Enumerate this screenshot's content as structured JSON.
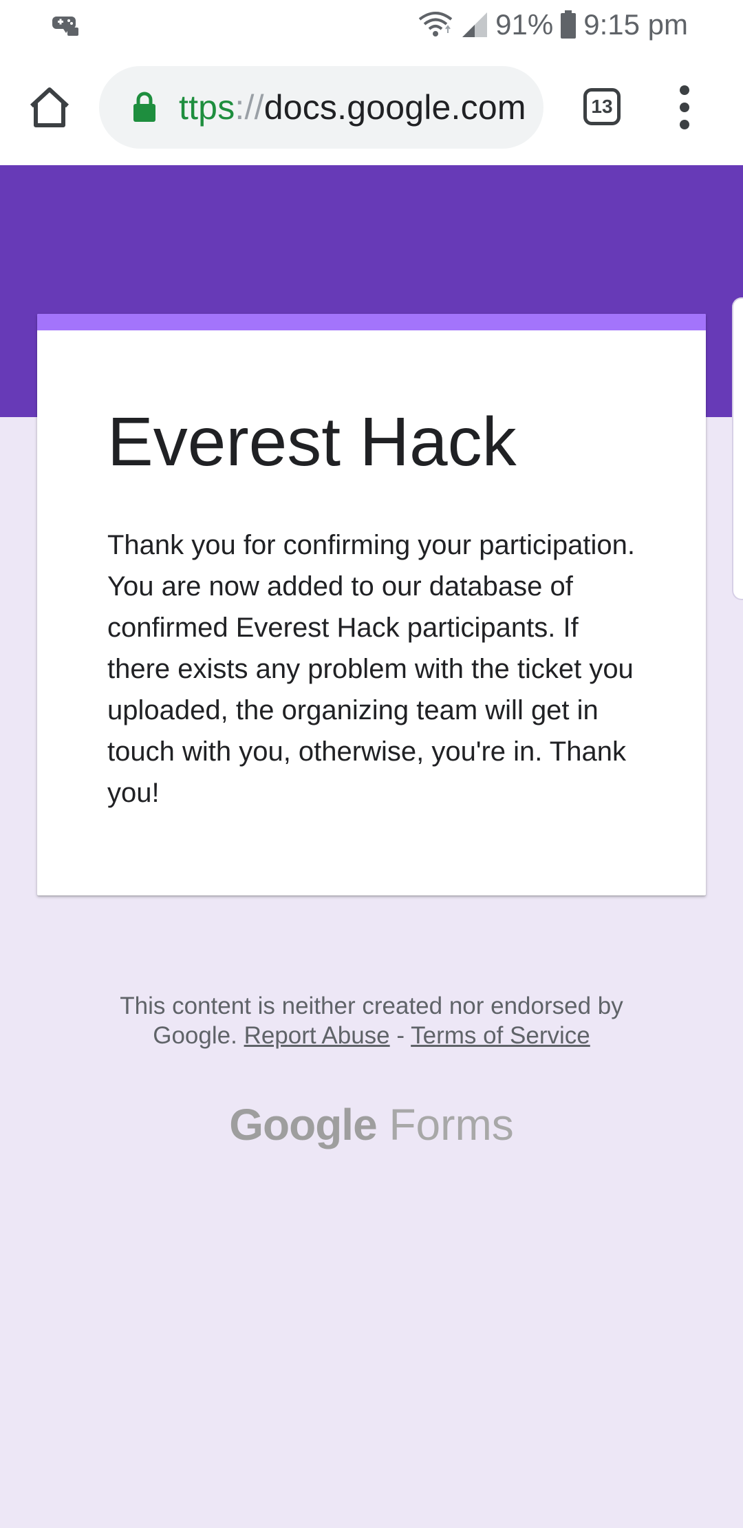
{
  "status_bar": {
    "battery": "91%",
    "time": "9:15 pm",
    "icons": [
      "game-notification-icon",
      "wifi-icon",
      "signal-icon",
      "battery-icon"
    ]
  },
  "browser": {
    "url_scheme": "ttps",
    "url_separator": "://",
    "url_host": "docs.google.com",
    "tab_count": "13",
    "icons": [
      "home-icon",
      "lock-icon",
      "more-vert-icon"
    ]
  },
  "form": {
    "title": "Everest Hack",
    "description": "Thank you for confirming your participation. You are now added to our database of confirmed Everest Hack participants. If there exists any problem with the ticket you uploaded, the organizing team will get in touch with you, otherwise, you're in. Thank you!"
  },
  "footer": {
    "disclaimer_line1": "This content is neither created nor endorsed by",
    "disclaimer_line2_prefix": "Google.",
    "report_abuse_label": "Report Abuse",
    "separator": "-",
    "terms_label": "Terms of Service",
    "brand_google": "Google",
    "brand_forms": "Forms"
  },
  "colors": {
    "header_purple": "#673ab7",
    "card_accent": "#a374fb",
    "page_background": "#ede7f6",
    "url_green": "#1e8e3e"
  }
}
